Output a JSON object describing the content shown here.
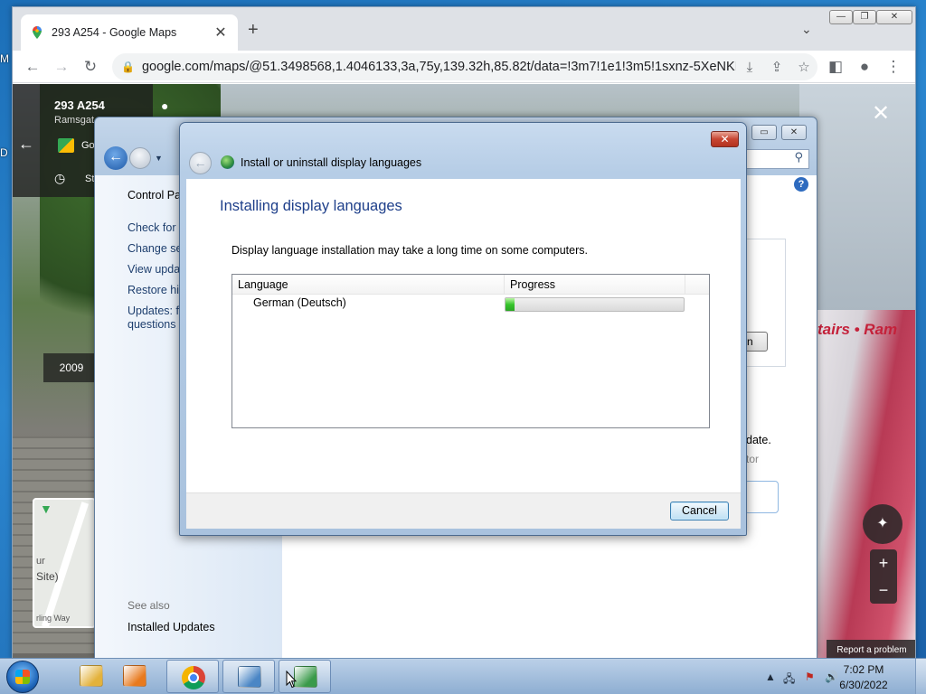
{
  "desktop": {
    "edge_letters": [
      "M",
      "D"
    ]
  },
  "chrome": {
    "tab": {
      "title": "293 A254 - Google Maps",
      "favicon": "google-maps-pin-icon"
    },
    "new_tab": "+",
    "tab_search": "⌄",
    "window_buttons": [
      "—",
      "❐",
      "✕"
    ],
    "url": "google.com/maps/@51.3498568,1.4046133,3a,75y,139.32h,85.82t/data=!3m7!1e1!3m5!1sxnz-5XeNKM...",
    "toolbar_icons": {
      "back": "←",
      "forward": "→",
      "reload": "↻",
      "lock": "🔒",
      "install": "⤓",
      "share": "⇪",
      "bookmark": "☆",
      "side_panel": "◧",
      "profile": "●",
      "menu": "⋮"
    }
  },
  "streetview": {
    "address": "293 A254",
    "town": "Ramsgat",
    "google_maps_label": "Go",
    "street_time": "St",
    "year": "2009",
    "minimap_label": "Site)",
    "minimap_prefix": "ur",
    "minimap_street": "rling Way",
    "bus_text": "tairs • Ram",
    "report": "Report a problem",
    "close": "✕",
    "zoom_in": "+",
    "zoom_out": "−",
    "back_arrow": "←"
  },
  "control_panel": {
    "search_icon": "⚲",
    "links": [
      "Control Pa",
      "Check for u",
      "Change set",
      "View updat",
      "Restore hid",
      "Updates: fr",
      "questions"
    ],
    "see_also": "See also",
    "installed_updates": "Installed Updates",
    "install_button_fragment": "n",
    "update_text": "date.",
    "admin_text": "tor",
    "help": "?"
  },
  "dialog": {
    "title": "Install or uninstall display languages",
    "close": "✕",
    "heading": "Installing display languages",
    "description": "Display language installation may take a long time on some computers.",
    "columns": [
      "Language",
      "Progress"
    ],
    "rows": [
      {
        "language": "German (Deutsch)",
        "progress_percent": 5
      }
    ],
    "cancel": "Cancel"
  },
  "taskbar": {
    "items": [
      {
        "name": "windows-explorer",
        "color": "#e3b23c",
        "open": false
      },
      {
        "name": "media-player",
        "color": "#e87a1e",
        "open": false
      },
      {
        "name": "google-chrome",
        "color": "#db4437",
        "open": true
      },
      {
        "name": "control-panel",
        "color": "#4a86c5",
        "open": true
      },
      {
        "name": "language-installer",
        "color": "#3a9a4a",
        "open": true
      }
    ],
    "tray_icons": [
      "▲",
      "🖧",
      "⚑",
      "🔊"
    ],
    "time": "7:02 PM",
    "date": "6/30/2022"
  }
}
